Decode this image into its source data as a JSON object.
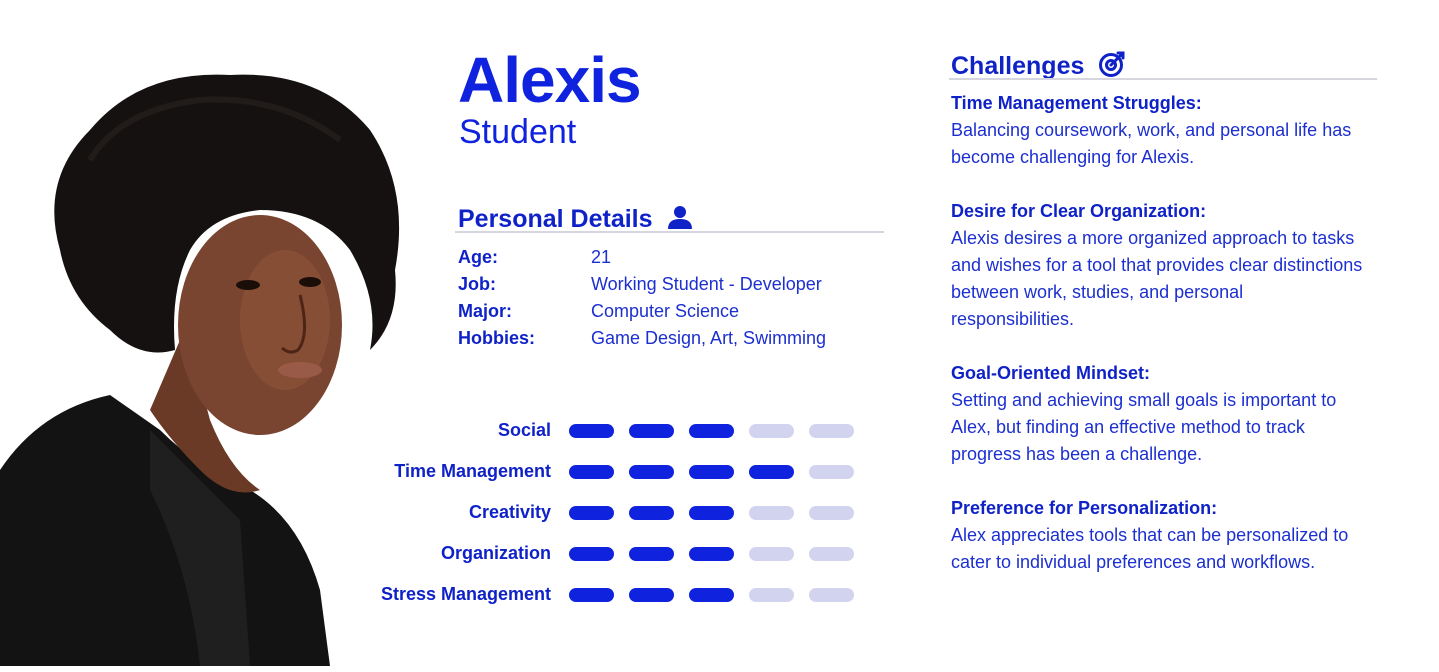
{
  "persona": {
    "name": "Alexis",
    "role": "Student"
  },
  "personal_details": {
    "heading": "Personal Details",
    "icon": "user-icon",
    "rows": [
      {
        "label": "Age:",
        "value": "21"
      },
      {
        "label": "Job:",
        "value": "Working Student - Developer"
      },
      {
        "label": "Major:",
        "value": "Computer Science"
      },
      {
        "label": "Hobbies:",
        "value": "Game Design, Art, Swimming"
      }
    ]
  },
  "skills": {
    "max": 5,
    "items": [
      {
        "label": "Social",
        "level": 3
      },
      {
        "label": "Time Management",
        "level": 4
      },
      {
        "label": "Creativity",
        "level": 3
      },
      {
        "label": "Organization",
        "level": 3
      },
      {
        "label": "Stress Management",
        "level": 3
      }
    ]
  },
  "challenges": {
    "heading": "Challenges",
    "icon": "target-icon",
    "items": [
      {
        "title": "Time Management Struggles:",
        "body": "Balancing coursework, work, and personal life has become challenging for Alexis."
      },
      {
        "title": "Desire for Clear Organization:",
        "body": "Alexis desires a more organized approach to tasks and wishes for a tool that provides clear distinctions between work, studies, and personal responsibilities."
      },
      {
        "title": "Goal-Oriented Mindset:",
        "body": "Setting and achieving small goals is important to Alex, but finding an effective method to track progress has been a challenge."
      },
      {
        "title": "Preference for Personalization:",
        "body": "Alex appreciates tools that can be personalized to cater to individual preferences and workflows."
      }
    ]
  },
  "colors": {
    "accent": "#0f22dd",
    "pill_off": "#d2d4ef",
    "rule": "#d5d6de"
  }
}
